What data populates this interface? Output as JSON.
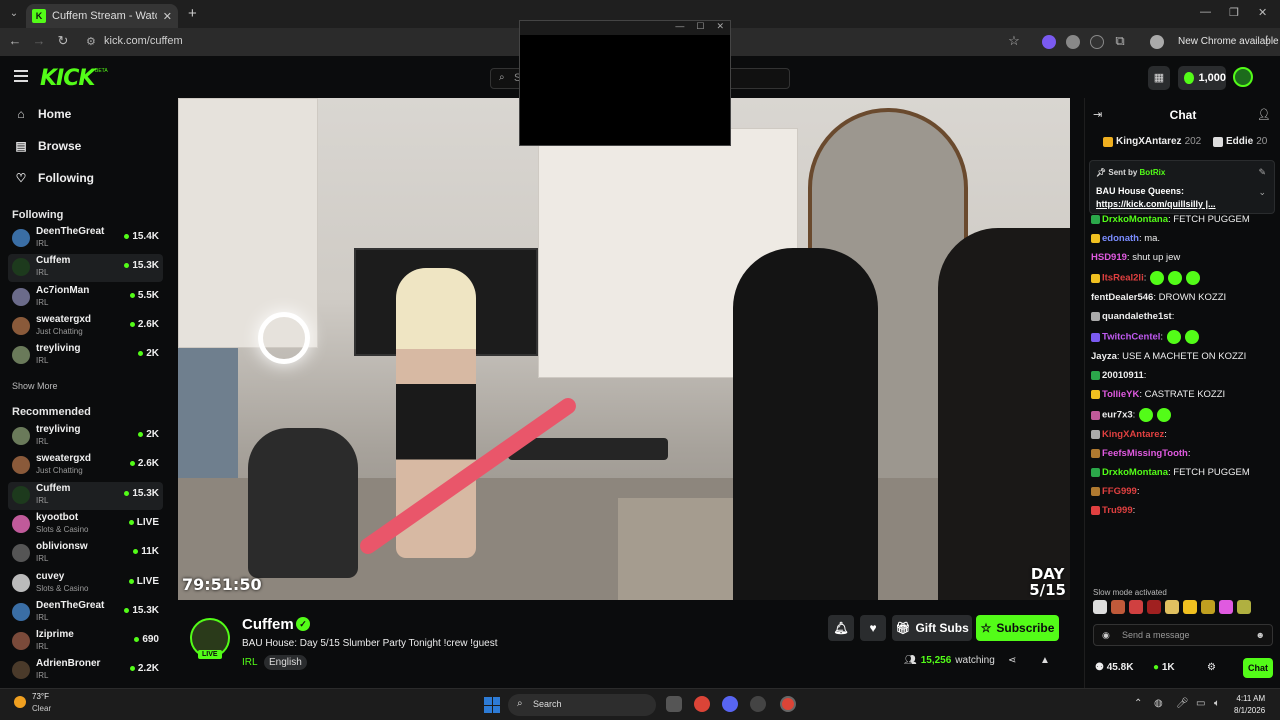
{
  "browser": {
    "tab_title": "Cuffem Stream - Watch Live on Kick",
    "url": "kick.com/cuffem",
    "new_chrome": "New Chrome available"
  },
  "header": {
    "logo": "KICK",
    "logo_badge": "BETA",
    "search_placeholder": "S",
    "credits": "1,000"
  },
  "sidebar": {
    "nav": [
      {
        "label": "Home",
        "icon": "home-icon"
      },
      {
        "label": "Browse",
        "icon": "browse-icon"
      },
      {
        "label": "Following",
        "icon": "heart-icon"
      }
    ],
    "following_title": "Following",
    "following": [
      {
        "name": "DeenTheGreat",
        "category": "IRL",
        "viewers": "15.4K",
        "color": "#3a6ea5"
      },
      {
        "name": "Cuffem",
        "category": "IRL",
        "viewers": "15.3K",
        "color": "#1d3a1d"
      },
      {
        "name": "Ac7ionMan",
        "category": "IRL",
        "viewers": "5.5K",
        "color": "#6b6b8a"
      },
      {
        "name": "sweatergxd",
        "category": "Just Chatting",
        "viewers": "2.6K",
        "color": "#8a5a3a"
      },
      {
        "name": "treyliving",
        "category": "IRL",
        "viewers": "2K",
        "color": "#6a7a5a"
      }
    ],
    "show_more": "Show More",
    "recommended_title": "Recommended",
    "recommended": [
      {
        "name": "treyliving",
        "category": "IRL",
        "viewers": "2K",
        "live": false,
        "color": "#6a7a5a"
      },
      {
        "name": "sweatergxd",
        "category": "Just Chatting",
        "viewers": "2.6K",
        "live": false,
        "color": "#8a5a3a"
      },
      {
        "name": "Cuffem",
        "category": "IRL",
        "viewers": "15.3K",
        "live": false,
        "color": "#1d3a1d"
      },
      {
        "name": "kyootbot",
        "category": "Slots & Casino",
        "viewers": "LIVE",
        "live": true,
        "color": "#c05a9a"
      },
      {
        "name": "oblivionsw",
        "category": "IRL",
        "viewers": "11K",
        "live": false,
        "color": "#555"
      },
      {
        "name": "cuvey",
        "category": "Slots & Casino",
        "viewers": "LIVE",
        "live": true,
        "color": "#bbb"
      },
      {
        "name": "DeenTheGreat",
        "category": "IRL",
        "viewers": "15.3K",
        "live": false,
        "color": "#3a6ea5"
      },
      {
        "name": "Iziprime",
        "category": "IRL",
        "viewers": "690",
        "live": false,
        "color": "#7a4a3a"
      },
      {
        "name": "AdrienBroner",
        "category": "IRL",
        "viewers": "2.2K",
        "live": false,
        "color": "#4a3a2a"
      }
    ]
  },
  "video": {
    "timer": "79:51:50",
    "day_label": "DAY",
    "day_value": "5/15"
  },
  "stream": {
    "name": "Cuffem",
    "live": "LIVE",
    "title": "BAU House: Day 5/15 Slumber Party Tonight !crew !guest",
    "category": "IRL",
    "language": "English",
    "gift_subs": "Gift Subs",
    "subscribe": "Subscribe",
    "watching_count": "15,256",
    "watching_label": "watching"
  },
  "chat": {
    "title": "Chat",
    "leaders": [
      {
        "name": "KingXAntarez",
        "count": "202",
        "color": "#f0b020"
      },
      {
        "name": "Eddie",
        "count": "20",
        "color": "#ddd"
      }
    ],
    "pinned_sent_by": "Sent by",
    "pinned_bot": "BotRix",
    "pinned_text": "BAU House Queens:",
    "pinned_link": "https://kick.com/quillsilly |...",
    "messages": [
      {
        "user": "DrxkoMontana",
        "text": ": FETCH PUGGEM",
        "color": "#53fc18",
        "badge": "#2ba84a"
      },
      {
        "user": "edonath",
        "text": ": ma.",
        "color": "#7a8cff",
        "badge": "#f0c020"
      },
      {
        "user": "HSD919",
        "text": ": shut up jew",
        "color": "#e05ae0",
        "badge": ""
      },
      {
        "user": "ItsReal2li",
        "text": ":",
        "color": "#e04040",
        "badge": "#f0c020",
        "emotes": 3
      },
      {
        "user": "fentDealer546",
        "text": ": DROWN KOZZI",
        "color": "#eee",
        "badge": ""
      },
      {
        "user": "quandalethe1st",
        "text": ":",
        "color": "#eee",
        "badge": "#aaa"
      },
      {
        "user": "TwitchCentel",
        "text": ":",
        "color": "#c05af0",
        "badge": "#7a5af0",
        "emotes": 2
      },
      {
        "user": "Jayza",
        "text": ": USE A MACHETE ON KOZZI",
        "color": "#eee",
        "badge": ""
      },
      {
        "user": "20010911",
        "text": ":",
        "color": "#eee",
        "badge": "#2ba84a"
      },
      {
        "user": "TollieYK",
        "text": ": CASTRATE KOZZI",
        "color": "#e05ae0",
        "badge": "#f0c020"
      },
      {
        "user": "eur7x3",
        "text": ":",
        "color": "#eee",
        "badge": "#c05a9a",
        "emotes": 2
      },
      {
        "user": "KingXAntarez",
        "text": ":",
        "color": "#e04040",
        "badge": "#aaa"
      },
      {
        "user": "FeefsMissingTooth",
        "text": ":",
        "color": "#e05ae0",
        "badge": "#b07a30"
      },
      {
        "user": "DrxkoMontana",
        "text": ": FETCH PUGGEM",
        "color": "#53fc18",
        "badge": "#2ba84a"
      },
      {
        "user": "FFG999",
        "text": ":",
        "color": "#e04040",
        "badge": "#b07a30"
      },
      {
        "user": "Tru999",
        "text": ":",
        "color": "#e04040",
        "badge": "#e04040"
      }
    ],
    "slow_mode": "Slow mode activated",
    "input_placeholder": "Send a message",
    "followers": "45.8K",
    "kicks": "1K",
    "send": "Chat"
  },
  "taskbar": {
    "temp": "73°F",
    "condition": "Clear",
    "search": "Search",
    "time": "4:11 AM",
    "date": "8/1/2026"
  }
}
